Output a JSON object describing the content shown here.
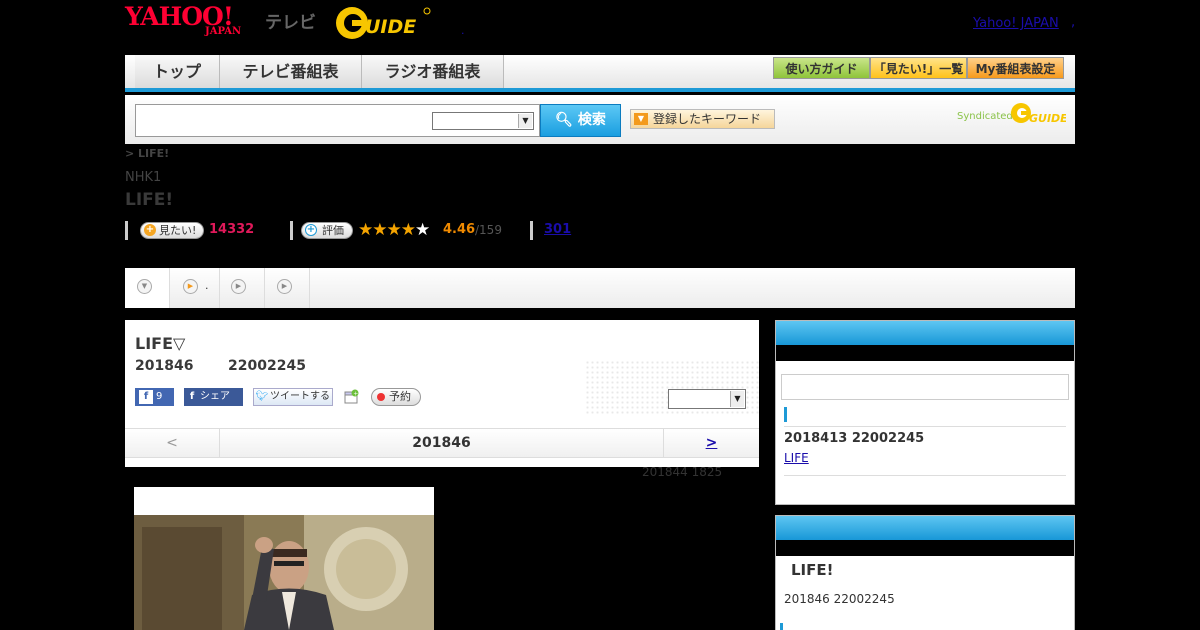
{
  "header": {
    "logo_yahoo": "YAHOO!",
    "logo_japan": "JAPAN",
    "logo_tv": "テレビ",
    "logo_gguide": "GGUIDE",
    "dot": ".",
    "yahoo_japan_link": "Yahoo! JAPAN",
    "yahoo_japan_sep": ","
  },
  "nav": {
    "tabs": [
      {
        "label": "トップ"
      },
      {
        "label": "テレビ番組表"
      },
      {
        "label": "ラジオ番組表"
      }
    ],
    "buttons": {
      "guide": "使い方ガイド",
      "mitai_list": "「見たい!」一覧",
      "my_program": "My番組表設定"
    }
  },
  "search": {
    "input_value": "",
    "select_value": "",
    "button_label": "検索",
    "keyword_button": "登録したキーワード",
    "syndicated": "Syndicated",
    "syndicated_logo": "GUIDE"
  },
  "program": {
    "breadcrumb": "> LIFE!",
    "channel": "NHK1",
    "title": "LIFE!",
    "mitai_label": "見たい!",
    "mitai_count": "14332",
    "rate_label": "評価",
    "stars": "★★★★★",
    "star_rating": 4.46,
    "rating": "4.46",
    "rating_count": "/159",
    "review_count": "301"
  },
  "tabs_strip": {
    "tab2_text": "."
  },
  "main": {
    "title": "LIFE▽",
    "date": "201846",
    "time": "22002245",
    "fb_like_count": "9",
    "fb_share": "シェア",
    "tweet": "ツイートする",
    "reserve": "予約",
    "select_value": "",
    "date_nav": {
      "prev": "<",
      "current": "201846",
      "next": ">"
    },
    "updated": "201844  1825"
  },
  "sidebar": {
    "box1": {
      "input_value": "",
      "info": "2018413  22002245",
      "link": "LIFE "
    },
    "box2": {
      "title": "LIFE!",
      "info": "201846  22002245"
    }
  },
  "colors": {
    "accent_blue": "#1e9ad6",
    "brand_red": "#ff0033",
    "mitai_pink": "#e0195a",
    "rating_orange": "#f08a00"
  }
}
